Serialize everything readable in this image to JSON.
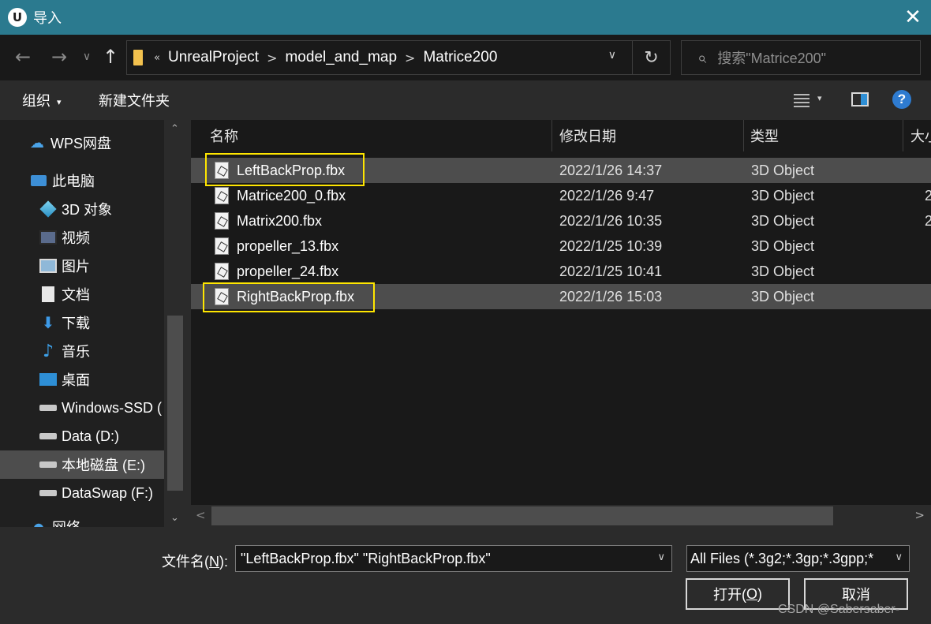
{
  "window": {
    "title": "导入",
    "app_icon": "U",
    "close_glyph": "✕"
  },
  "nav": {
    "back": "←",
    "forward": "→",
    "recent": "∨",
    "up": "↑"
  },
  "address": {
    "overflow": "«",
    "separator": ">",
    "crumbs": [
      "UnrealProject",
      "model_and_map",
      "Matrice200"
    ],
    "dropdown": "∨",
    "refresh": "↻"
  },
  "search": {
    "placeholder": "搜索\"Matrice200\"",
    "icon": "⌕"
  },
  "toolbar": {
    "organize": "组织",
    "organize_caret": "▾",
    "new_folder": "新建文件夹",
    "view_caret": "▾",
    "help": "?"
  },
  "sidebar": {
    "items": [
      {
        "label": "WPS网盘",
        "icon": "cloud-icon"
      },
      {
        "label": "此电脑",
        "icon": "computer-icon"
      },
      {
        "label": "3D 对象",
        "icon": "3d-objects-icon"
      },
      {
        "label": "视频",
        "icon": "video-icon"
      },
      {
        "label": "图片",
        "icon": "pictures-icon"
      },
      {
        "label": "文档",
        "icon": "documents-icon"
      },
      {
        "label": "下载",
        "icon": "download-icon"
      },
      {
        "label": "音乐",
        "icon": "music-icon"
      },
      {
        "label": "桌面",
        "icon": "desktop-icon"
      },
      {
        "label": "Windows-SSD (",
        "icon": "drive-icon"
      },
      {
        "label": "Data (D:)",
        "icon": "drive-icon"
      },
      {
        "label": "本地磁盘 (E:)",
        "icon": "drive-icon",
        "selected": true
      },
      {
        "label": "DataSwap (F:)",
        "icon": "drive-icon"
      },
      {
        "label": "网络",
        "icon": "network-icon"
      }
    ],
    "scroll_up": "⌃",
    "scroll_down": "⌄"
  },
  "columns": {
    "name": "名称",
    "modified": "修改日期",
    "type": "类型",
    "size": "大小",
    "sort_caret": "^"
  },
  "files": [
    {
      "name": "LeftBackProp.fbx",
      "modified": "2022/1/26 14:37",
      "type": "3D Object",
      "size": "",
      "selected": true,
      "highlighted": true
    },
    {
      "name": "Matrice200_0.fbx",
      "modified": "2022/1/26 9:47",
      "type": "3D Object",
      "size": "2"
    },
    {
      "name": "Matrix200.fbx",
      "modified": "2022/1/26 10:35",
      "type": "3D Object",
      "size": "2"
    },
    {
      "name": "propeller_13.fbx",
      "modified": "2022/1/25 10:39",
      "type": "3D Object",
      "size": ""
    },
    {
      "name": "propeller_24.fbx",
      "modified": "2022/1/25 10:41",
      "type": "3D Object",
      "size": ""
    },
    {
      "name": "RightBackProp.fbx",
      "modified": "2022/1/26 15:03",
      "type": "3D Object",
      "size": "",
      "selected": true,
      "highlighted": true
    }
  ],
  "hscroll": {
    "left": "<",
    "right": ">"
  },
  "footer": {
    "filename_label_pre": "文件名(",
    "filename_label_key": "N",
    "filename_label_post": "):",
    "filename_value": "\"LeftBackProp.fbx\" \"RightBackProp.fbx\"",
    "filter_value": "All Files (*.3g2;*.3gp;*.3gpp;*",
    "open_pre": "打开(",
    "open_key": "O",
    "open_post": ")",
    "cancel": "取消",
    "watermark": "CSDN @Sabersaber-"
  },
  "colors": {
    "titlebar": "#2b7a8f",
    "highlight_box": "#ffe600",
    "selection": "#4d4d4d",
    "background": "#191919"
  }
}
